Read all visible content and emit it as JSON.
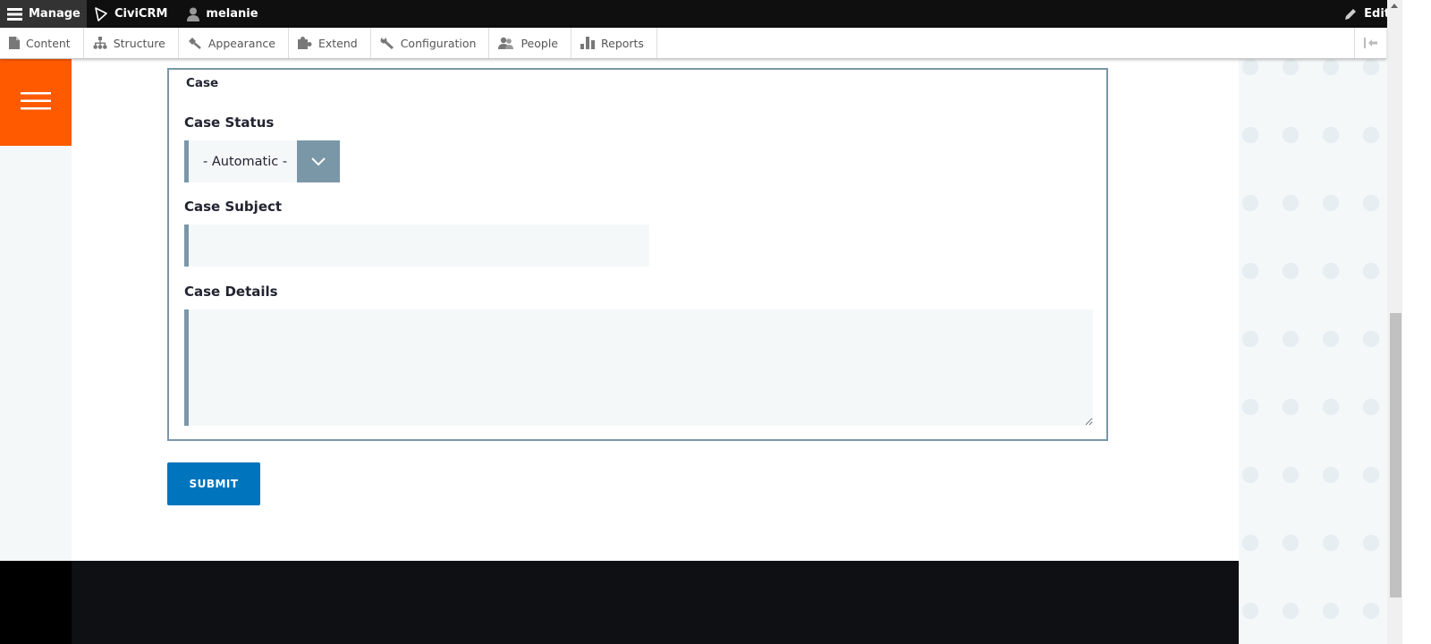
{
  "toolbar": {
    "manage_label": "Manage",
    "civicrm_label": "CiviCRM",
    "user_label": "melanie",
    "edit_label": "Edit"
  },
  "tray": {
    "items": [
      {
        "label": "Content",
        "icon": "page-icon"
      },
      {
        "label": "Structure",
        "icon": "sitemap-icon"
      },
      {
        "label": "Appearance",
        "icon": "paintbrush-icon"
      },
      {
        "label": "Extend",
        "icon": "puzzle-icon"
      },
      {
        "label": "Configuration",
        "icon": "wrench-icon"
      },
      {
        "label": "People",
        "icon": "people-icon"
      },
      {
        "label": "Reports",
        "icon": "bar-chart-icon"
      }
    ]
  },
  "form": {
    "legend": "Case",
    "case_status": {
      "label": "Case Status",
      "value": "- Automatic -"
    },
    "case_subject": {
      "label": "Case Subject",
      "value": "",
      "placeholder": ""
    },
    "case_details": {
      "label": "Case Details",
      "value": "",
      "placeholder": ""
    },
    "submit_label": "SUBMIT"
  },
  "colors": {
    "accent_orange": "#ff5a00",
    "submit_blue": "#0074bd",
    "field_border": "#7a97a8"
  }
}
